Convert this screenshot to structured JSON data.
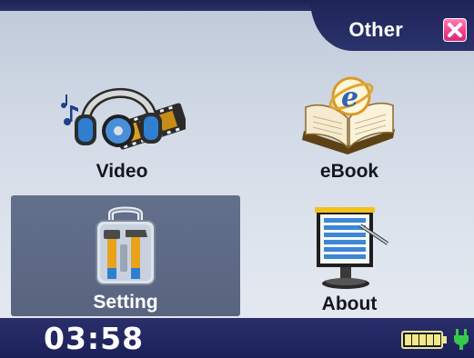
{
  "header": {
    "title": "Other",
    "close_icon": "close-icon",
    "close_color": "#f2428b"
  },
  "menu": {
    "items": [
      {
        "label": "Video",
        "icon": "video-icon",
        "selected": false
      },
      {
        "label": "eBook",
        "icon": "ebook-icon",
        "selected": false
      },
      {
        "label": "Setting",
        "icon": "toolbox-icon",
        "selected": true
      },
      {
        "label": "About",
        "icon": "about-icon",
        "selected": false
      }
    ]
  },
  "status": {
    "time": "03:58",
    "battery_icon": "battery-icon",
    "battery_level": 1.0,
    "charging_icon": "plug-icon",
    "accent": "#1c2058"
  }
}
